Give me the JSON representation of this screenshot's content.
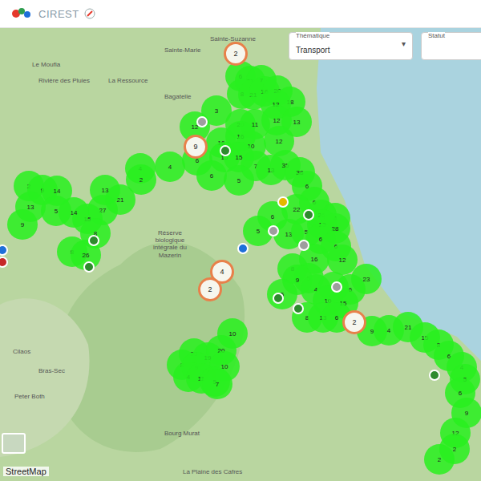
{
  "header": {
    "title": "CIREST"
  },
  "filters": [
    {
      "label": "Thématique",
      "value": "Transport",
      "caret": "▾"
    },
    {
      "label": "Statut"
    }
  ],
  "map": {
    "places": [
      "Le Moufia",
      "Sainte-Marie",
      "Sainte-Suzanne",
      "Rivière des Pluies",
      "La Ressource",
      "Bagatelle",
      "Réserve biologique intégrale du Mazerin",
      "Cilaos",
      "Bras-Sec",
      "Peter Both",
      "Bourg Murat",
      "La Plaine des Cafres"
    ],
    "clusters": [
      {
        "count": "6",
        "kind": "green"
      },
      {
        "count": "21",
        "kind": "green"
      },
      {
        "count": "7",
        "kind": "green"
      },
      {
        "count": "8",
        "kind": "green"
      },
      {
        "count": "21",
        "kind": "green"
      },
      {
        "count": "16",
        "kind": "green"
      },
      {
        "count": "20",
        "kind": "green"
      },
      {
        "count": "18",
        "kind": "green"
      },
      {
        "count": "12",
        "kind": "green"
      },
      {
        "count": "3",
        "kind": "green"
      },
      {
        "count": "20",
        "kind": "green"
      },
      {
        "count": "11",
        "kind": "green"
      },
      {
        "count": "12",
        "kind": "green"
      },
      {
        "count": "13",
        "kind": "green"
      },
      {
        "count": "12",
        "kind": "green"
      },
      {
        "count": "16",
        "kind": "green"
      },
      {
        "count": "16",
        "kind": "green"
      },
      {
        "count": "10",
        "kind": "green"
      },
      {
        "count": "12",
        "kind": "green"
      },
      {
        "count": "6",
        "kind": "green"
      },
      {
        "count": "15",
        "kind": "green"
      },
      {
        "count": "15",
        "kind": "green"
      },
      {
        "count": "7",
        "kind": "green"
      },
      {
        "count": "13",
        "kind": "green"
      },
      {
        "count": "35",
        "kind": "green"
      },
      {
        "count": "38",
        "kind": "green"
      },
      {
        "count": "6",
        "kind": "green"
      },
      {
        "count": "5",
        "kind": "green"
      },
      {
        "count": "4",
        "kind": "green"
      },
      {
        "count": "4",
        "kind": "green"
      },
      {
        "count": "2",
        "kind": "green"
      },
      {
        "count": "21",
        "kind": "green"
      },
      {
        "count": "13",
        "kind": "green"
      },
      {
        "count": "27",
        "kind": "green"
      },
      {
        "count": "15",
        "kind": "green"
      },
      {
        "count": "2",
        "kind": "green"
      },
      {
        "count": "9",
        "kind": "green"
      },
      {
        "count": "14",
        "kind": "green"
      },
      {
        "count": "14",
        "kind": "green"
      },
      {
        "count": "13",
        "kind": "green"
      },
      {
        "count": "5",
        "kind": "green"
      },
      {
        "count": "9",
        "kind": "green"
      },
      {
        "count": "8",
        "kind": "green"
      },
      {
        "count": "26",
        "kind": "green"
      },
      {
        "count": "8",
        "kind": "green"
      },
      {
        "count": "6",
        "kind": "green"
      },
      {
        "count": "6",
        "kind": "green"
      },
      {
        "count": "22",
        "kind": "green"
      },
      {
        "count": "26",
        "kind": "green"
      },
      {
        "count": "4",
        "kind": "green"
      },
      {
        "count": "6",
        "kind": "green"
      },
      {
        "count": "5",
        "kind": "green"
      },
      {
        "count": "13",
        "kind": "green"
      },
      {
        "count": "5",
        "kind": "green"
      },
      {
        "count": "13",
        "kind": "green"
      },
      {
        "count": "28",
        "kind": "green"
      },
      {
        "count": "6",
        "kind": "green"
      },
      {
        "count": "6",
        "kind": "green"
      },
      {
        "count": "16",
        "kind": "green"
      },
      {
        "count": "12",
        "kind": "green"
      },
      {
        "count": "8",
        "kind": "green"
      },
      {
        "count": "5",
        "kind": "green"
      },
      {
        "count": "9",
        "kind": "green"
      },
      {
        "count": "4",
        "kind": "green"
      },
      {
        "count": "9",
        "kind": "green"
      },
      {
        "count": "6",
        "kind": "green"
      },
      {
        "count": "23",
        "kind": "green"
      },
      {
        "count": "10",
        "kind": "green"
      },
      {
        "count": "5",
        "kind": "green"
      },
      {
        "count": "15",
        "kind": "green"
      },
      {
        "count": "8",
        "kind": "green"
      },
      {
        "count": "13",
        "kind": "green"
      },
      {
        "count": "6",
        "kind": "green"
      },
      {
        "count": "9",
        "kind": "green"
      },
      {
        "count": "4",
        "kind": "green"
      },
      {
        "count": "21",
        "kind": "green"
      },
      {
        "count": "15",
        "kind": "green"
      },
      {
        "count": "3",
        "kind": "green"
      },
      {
        "count": "6",
        "kind": "green"
      },
      {
        "count": "4",
        "kind": "green"
      },
      {
        "count": "5",
        "kind": "green"
      },
      {
        "count": "6",
        "kind": "green"
      },
      {
        "count": "9",
        "kind": "green"
      },
      {
        "count": "12",
        "kind": "green"
      },
      {
        "count": "2",
        "kind": "green"
      },
      {
        "count": "2",
        "kind": "green"
      },
      {
        "count": "10",
        "kind": "green"
      },
      {
        "count": "23",
        "kind": "green"
      },
      {
        "count": "19",
        "kind": "green"
      },
      {
        "count": "20",
        "kind": "green"
      },
      {
        "count": "8",
        "kind": "green"
      },
      {
        "count": "9",
        "kind": "green"
      },
      {
        "count": "10",
        "kind": "green"
      },
      {
        "count": "4",
        "kind": "green"
      },
      {
        "count": "11",
        "kind": "green"
      },
      {
        "count": "5",
        "kind": "green"
      },
      {
        "count": "7",
        "kind": "green"
      },
      {
        "count": "2",
        "kind": "orange"
      },
      {
        "count": "9",
        "kind": "orange"
      },
      {
        "count": "4",
        "kind": "orange"
      },
      {
        "count": "2",
        "kind": "orange"
      },
      {
        "count": "2",
        "kind": "orange"
      }
    ],
    "markers": [
      {
        "color": "#9e9e9e"
      },
      {
        "color": "#2e8b2e"
      },
      {
        "color": "#9e9e9e"
      },
      {
        "color": "#2e8b2e"
      },
      {
        "color": "#9e9e9e"
      },
      {
        "color": "#1e6fd9"
      },
      {
        "color": "#2e8b2e"
      },
      {
        "color": "#2e8b2e"
      },
      {
        "color": "#9e9e9e"
      },
      {
        "color": "#2e8b2e"
      },
      {
        "color": "#2e8b2e"
      },
      {
        "color": "#2e8b2e"
      },
      {
        "color": "#e5b800"
      },
      {
        "color": "#1e6fd9"
      },
      {
        "color": "#c62828"
      }
    ],
    "attribution": "StreetMap"
  }
}
